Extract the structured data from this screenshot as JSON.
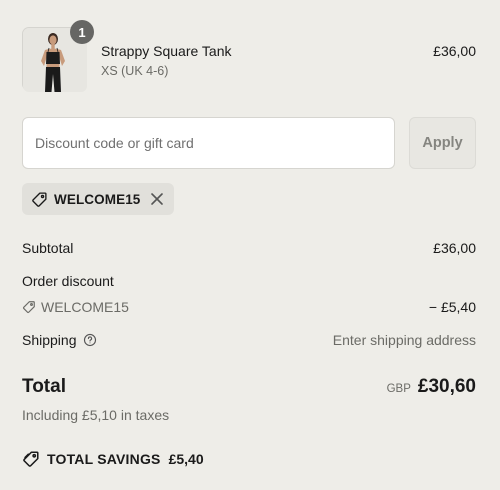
{
  "product": {
    "name": "Strappy Square Tank",
    "variant": "XS (UK 4-6)",
    "price": "£36,00",
    "quantity": "1",
    "image_icon": "product-photo"
  },
  "discount": {
    "placeholder": "Discount code or gift card",
    "value": "",
    "apply_label": "Apply",
    "applied_code": "WELCOME15"
  },
  "summary": {
    "subtotal_label": "Subtotal",
    "subtotal_value": "£36,00",
    "order_discount_label": "Order discount",
    "discount_code": "WELCOME15",
    "discount_amount": "− £5,40",
    "shipping_label": "Shipping",
    "shipping_value": "Enter shipping address",
    "total_label": "Total",
    "currency": "GBP",
    "total_value": "£30,60",
    "taxes_note": "Including £5,10 in taxes",
    "savings_label": "TOTAL SAVINGS",
    "savings_amount": "£5,40"
  },
  "colors": {
    "background": "#eeede8",
    "badge": "#666664",
    "muted_text": "#6b6b66"
  }
}
